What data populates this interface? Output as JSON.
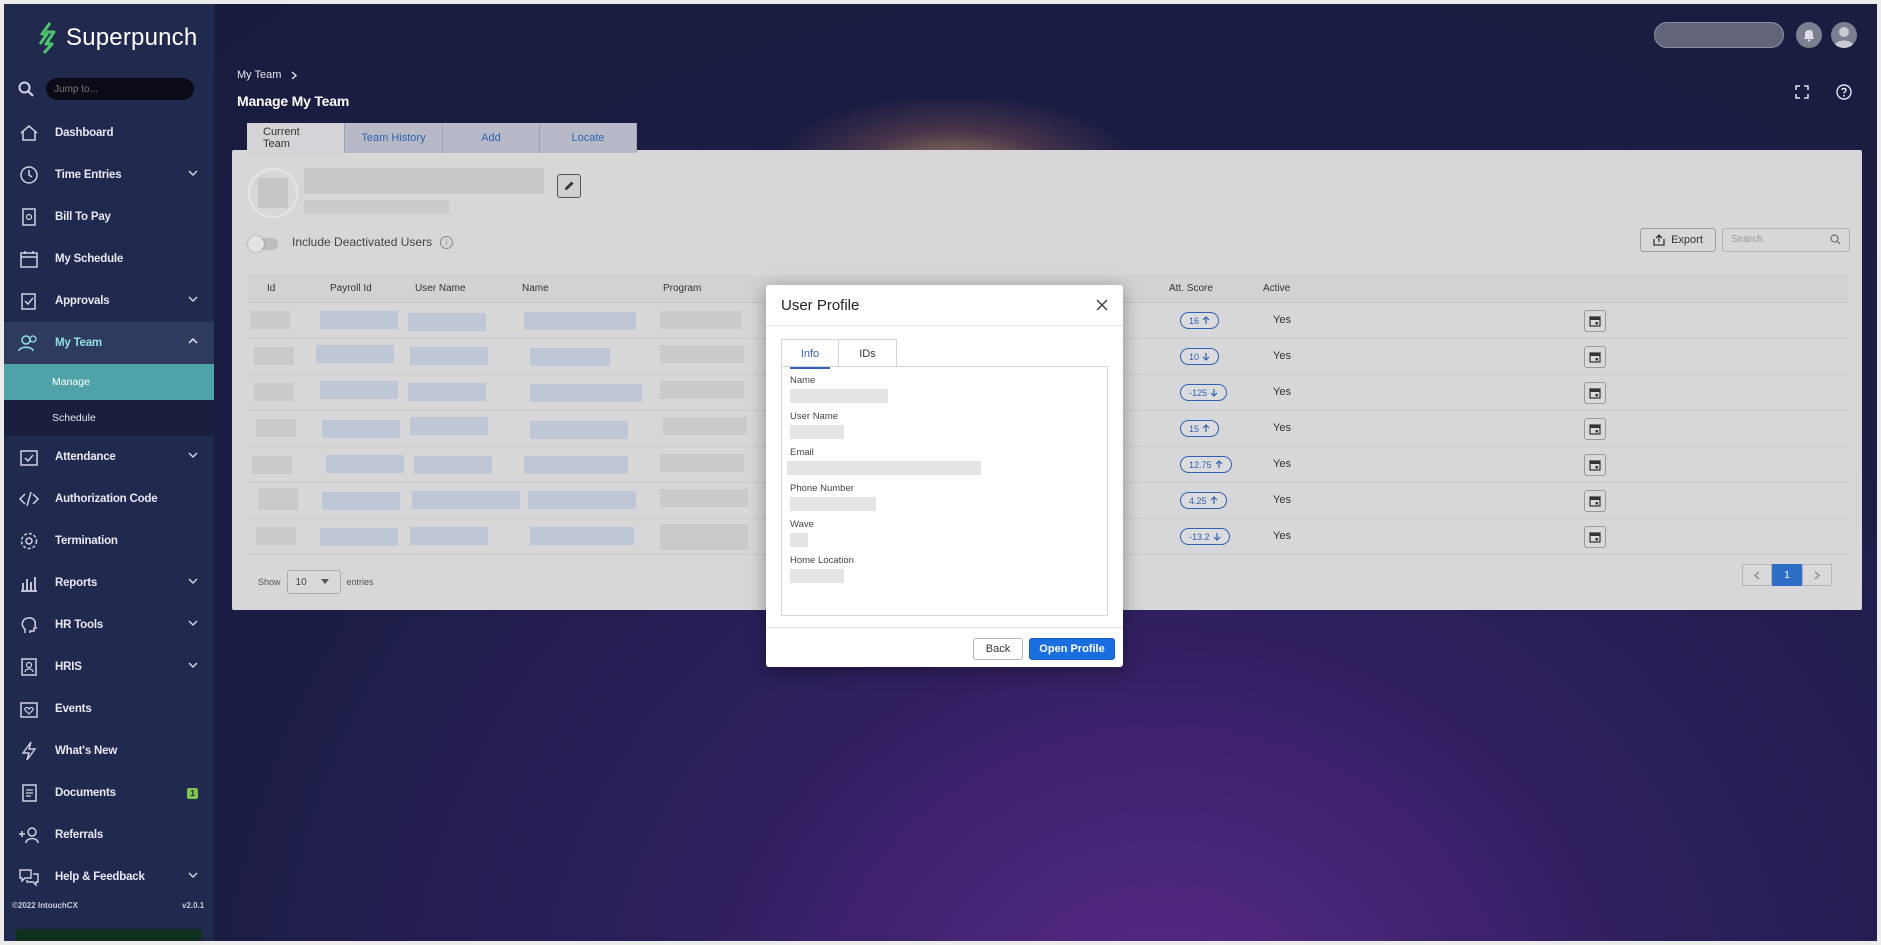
{
  "brand": {
    "name": "Superpunch"
  },
  "sidebar": {
    "search_placeholder": "Jump to...",
    "items": [
      {
        "label": "Dashboard",
        "icon": "home-icon"
      },
      {
        "label": "Time Entries",
        "icon": "clock-icon"
      },
      {
        "label": "Bill To Pay",
        "icon": "bill-icon"
      },
      {
        "label": "My Schedule",
        "icon": "calendar-icon"
      },
      {
        "label": "Approvals",
        "icon": "approval-icon"
      },
      {
        "label": "My Team",
        "icon": "team-icon"
      },
      {
        "label": "Attendance",
        "icon": "attendance-icon"
      },
      {
        "label": "Authorization Code",
        "icon": "code-icon"
      },
      {
        "label": "Termination",
        "icon": "gear-icon"
      },
      {
        "label": "Reports",
        "icon": "chart-icon"
      },
      {
        "label": "HR Tools",
        "icon": "head-icon"
      },
      {
        "label": "HRIS",
        "icon": "hris-icon"
      },
      {
        "label": "Events",
        "icon": "events-icon"
      },
      {
        "label": "What's New",
        "icon": "bolt-icon"
      },
      {
        "label": "Documents",
        "icon": "document-icon",
        "badge": "1"
      },
      {
        "label": "Referrals",
        "icon": "referral-icon"
      },
      {
        "label": "Help & Feedback",
        "icon": "chat-icon"
      }
    ],
    "sub_items": [
      {
        "label": "Manage"
      },
      {
        "label": "Schedule"
      }
    ],
    "copyright": "©2022 IntouchCX",
    "version": "v2.0.1"
  },
  "header": {
    "breadcrumb": "My Team",
    "title": "Manage My Team"
  },
  "tabs": [
    "Current Team",
    "Team History",
    "Add",
    "Locate"
  ],
  "toolbar": {
    "include_deactivated": "Include Deactivated Users",
    "export": "Export",
    "search_placeholder": "Search"
  },
  "table": {
    "columns": [
      "Id",
      "Payroll Id",
      "User Name",
      "Name",
      "Program",
      "Att. Score",
      "Active"
    ],
    "rows": [
      {
        "score": "16",
        "trend": "up",
        "active": "Yes"
      },
      {
        "score": "10",
        "trend": "down",
        "active": "Yes"
      },
      {
        "score": "-125",
        "trend": "down",
        "active": "Yes"
      },
      {
        "score": "15",
        "trend": "up",
        "active": "Yes"
      },
      {
        "score": "12.75",
        "trend": "up",
        "active": "Yes"
      },
      {
        "score": "4.25",
        "trend": "up",
        "active": "Yes"
      },
      {
        "score": "-13.2",
        "trend": "down",
        "active": "Yes"
      }
    ],
    "show_label": "Show",
    "entries_value": "10",
    "entries_label": "entries",
    "page": "1"
  },
  "modal": {
    "title": "User Profile",
    "tabs": [
      "Info",
      "IDs"
    ],
    "fields": [
      "Name",
      "User Name",
      "Email",
      "Phone Number",
      "Wave",
      "Home Location"
    ],
    "back": "Back",
    "open": "Open Profile"
  },
  "colors": {
    "sidebar": "#22294f",
    "accent": "#1a6fe0",
    "active_sub": "#4fa3a8",
    "active_text": "#8ee1e6"
  }
}
